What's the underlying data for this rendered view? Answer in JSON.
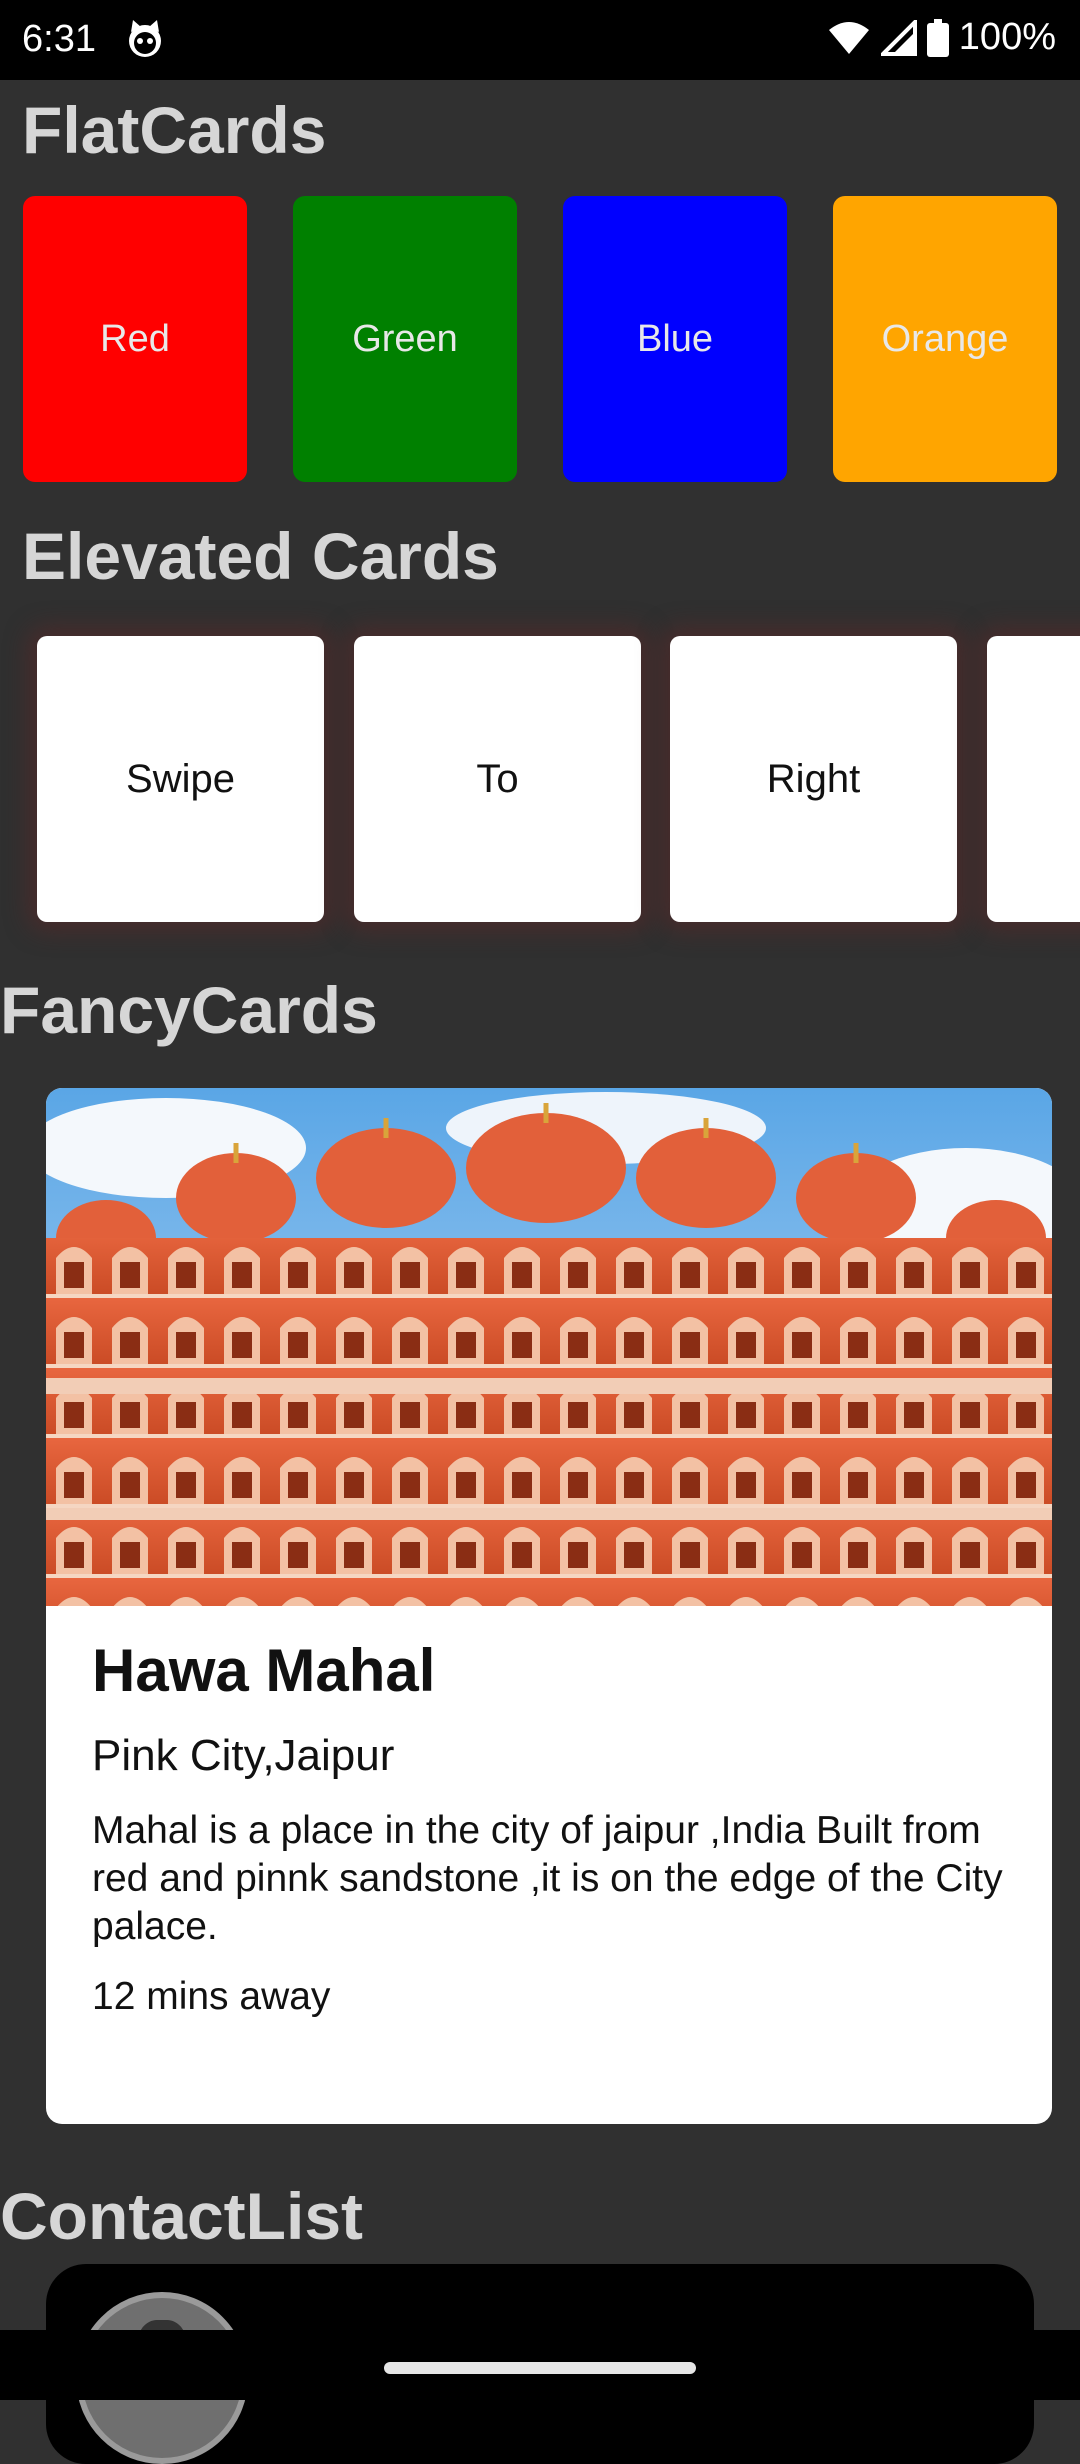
{
  "status_bar": {
    "time": "6:31",
    "app_icon": "cat-face-icon",
    "wifi_icon": "wifi-icon",
    "signal_icon": "cell-signal-icon",
    "battery_icon": "battery-icon",
    "battery_level": "100%"
  },
  "flat_cards": {
    "title": "FlatCards",
    "items": [
      {
        "label": "Red",
        "color": "#ff0000"
      },
      {
        "label": "Green",
        "color": "#008000"
      },
      {
        "label": "Blue",
        "color": "#0000ff"
      },
      {
        "label": "Orange",
        "color": "#ffa500"
      }
    ]
  },
  "elevated_cards": {
    "title": "Elevated Cards",
    "items": [
      "Swipe",
      "To",
      "Right"
    ]
  },
  "fancy_cards": {
    "title": "FancyCards",
    "card": {
      "image_alt": "hawa-mahal-photo",
      "title": "Hawa Mahal",
      "subtitle": "Pink City,Jaipur",
      "description": "Mahal is a place in the city of jaipur ,India Built from red and pinnk sandstone ,it is on the edge of the City palace.",
      "eta": "12 mins away"
    }
  },
  "contact_list": {
    "title": "ContactList"
  },
  "colors": {
    "background": "#303030",
    "section_title": "#d6d6d6"
  }
}
